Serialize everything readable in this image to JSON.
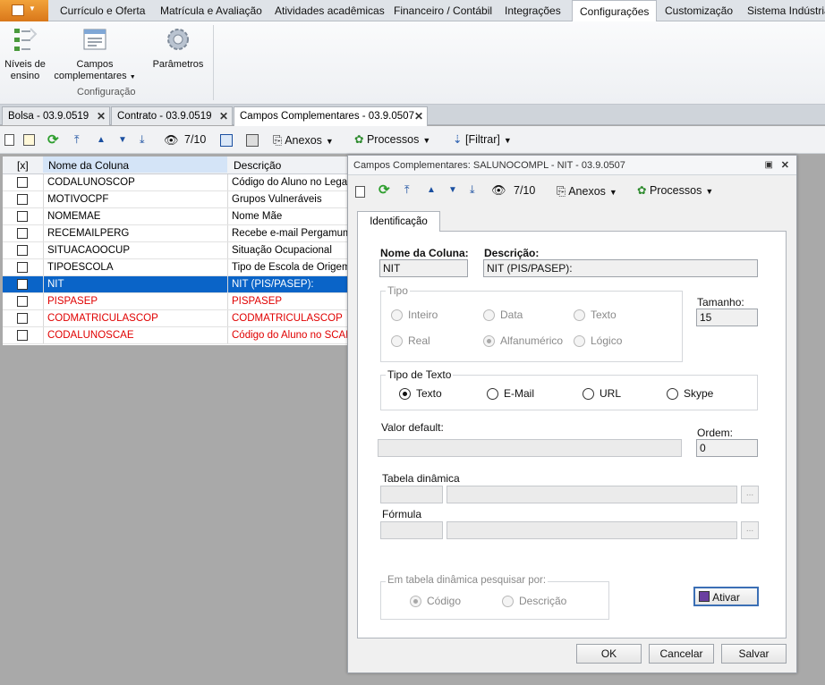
{
  "ribbon": {
    "tabs": [
      "Currículo e Oferta",
      "Matrícula e Avaliação",
      "Atividades acadêmicas",
      "Financeiro / Contábil",
      "Integrações",
      "Configurações",
      "Customização",
      "Sistema Indústria"
    ],
    "buttons": {
      "niveis": "Níveis de ensino",
      "campos": "Campos complementares",
      "parametros": "Parâmetros"
    },
    "group_label": "Configuração"
  },
  "doc_tabs": [
    {
      "label": "Bolsa - 03.9.0519"
    },
    {
      "label": "Contrato - 03.9.0519"
    },
    {
      "label": "Campos Complementares - 03.9.0507"
    }
  ],
  "toolbar": {
    "counter": "7/10",
    "anexos": "Anexos",
    "processos": "Processos",
    "filtrar": "[Filtrar]"
  },
  "grid": {
    "headers": [
      "[x]",
      "Nome da Coluna",
      "Descrição"
    ],
    "rows": [
      {
        "nome": "CODALUNOSCOP",
        "descricao": "Código do Aluno no Legado"
      },
      {
        "nome": "MOTIVOCPF",
        "descricao": "Grupos Vulneráveis"
      },
      {
        "nome": "NOMEMAE",
        "descricao": "Nome Mãe"
      },
      {
        "nome": "RECEMAILPERG",
        "descricao": "Recebe e-mail Pergamum:"
      },
      {
        "nome": "SITUACAOOCUP",
        "descricao": "Situação Ocupacional"
      },
      {
        "nome": "TIPOESCOLA",
        "descricao": "Tipo de Escola de Origem"
      },
      {
        "nome": "NIT",
        "descricao": "NIT (PIS/PASEP):"
      },
      {
        "nome": "PISPASEP",
        "descricao": "PISPASEP"
      },
      {
        "nome": "CODMATRICULASCOP",
        "descricao": "CODMATRICULASCOP"
      },
      {
        "nome": "CODALUNOSCAE",
        "descricao": "Código do Aluno no SCAE"
      }
    ]
  },
  "dialog": {
    "title": "Campos Complementares: SALUNOCOMPL - NIT - 03.9.0507",
    "counter": "7/10",
    "anexos": "Anexos",
    "processos": "Processos",
    "tab": "Identificação",
    "nome_label": "Nome da Coluna:",
    "nome_value": "NIT",
    "desc_label": "Descrição:",
    "desc_value": "NIT (PIS/PASEP):",
    "tipo_label": "Tipo",
    "tipo_options": [
      "Inteiro",
      "Data",
      "Texto",
      "Real",
      "Alfanumérico",
      "Lógico"
    ],
    "tamanho_label": "Tamanho:",
    "tamanho_value": "15",
    "tipo_texto_label": "Tipo de Texto",
    "tipo_texto_options": [
      "Texto",
      "E-Mail",
      "URL",
      "Skype"
    ],
    "valor_default_label": "Valor default:",
    "ordem_label": "Ordem:",
    "ordem_value": "0",
    "tabela_label": "Tabela dinâmica",
    "formula_label": "Fórmula",
    "pesquisar_label": "Em tabela dinâmica pesquisar por:",
    "pesquisar_options": [
      "Código",
      "Descrição"
    ],
    "ativar": "Ativar",
    "ok": "OK",
    "cancelar": "Cancelar",
    "salvar": "Salvar"
  }
}
